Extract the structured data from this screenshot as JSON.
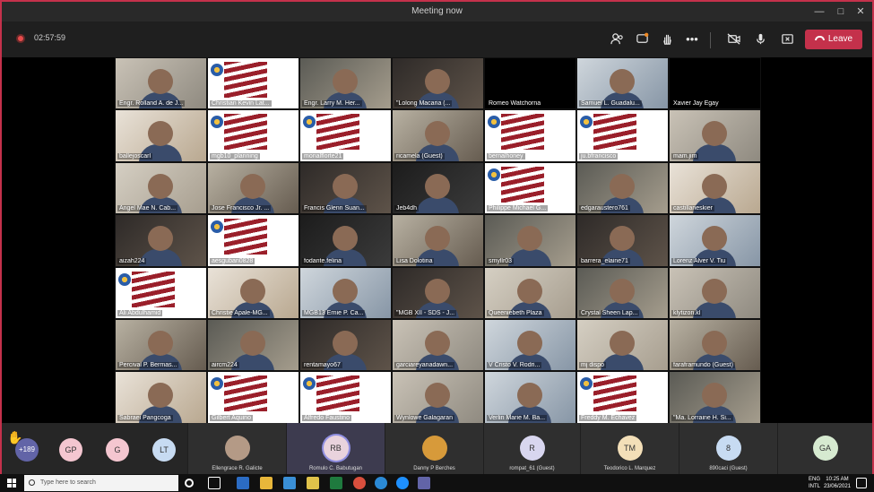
{
  "window": {
    "title": "Meeting now"
  },
  "toolbar": {
    "timer": "02:57:59",
    "leave_label": "Leave"
  },
  "tiles": [
    "Engr. Rolland A. de J...",
    "Christian Kevin Lat...",
    "Engr. Larry M. Her...",
    "\"Lolong Macaria (...",
    "Romeo Watchorna",
    "Samuel L. Guadalu...",
    "Xavier Jay Egay",
    "ballejoscarl",
    "mgb10_planning",
    "monalflorte21",
    "ricamela (Guest)",
    "bernalhoney",
    "ju.bfrancisco",
    "mam.jim",
    "Angel Mae N. Cab...",
    "Jose Francisco Jr. ...",
    "Francis Glenn Suan...",
    "Jeb4dh",
    "Philippe Michael G...",
    "edgaraustero761",
    "castillaneskier",
    "aizah224",
    "aesguban0828",
    "fodante.felina",
    "Lisa Dolotina",
    "smyllr03",
    "barrera_elaine71",
    "Lorenz Alver V. Tiu",
    "Ali Abdulhamid",
    "Christie Apale-MG...",
    "MGB13 Ernie P. Ca...",
    "\"MGB XII - SDS - J...",
    "Queeniebeth Plaza",
    "Crystal Sheen Lap...",
    "klytizon.kl",
    "Percival P. Bermas...",
    "aircm224",
    "rentamayo67",
    "garciareyanadawn...",
    "V Cristo V. Rodri...",
    "mj dispo",
    "faraframundo (Guest)",
    "Sabraei Pangcoga",
    "Gilbert Aquino",
    "Alfredo Faustino",
    "Wynlowe Galagaran",
    "Verlin Marie M. Ba...",
    "Freddy M. Echavez",
    "\"Ma. Lorraine H. Si..."
  ],
  "strip": {
    "overflow": "+189",
    "initials": [
      "GP",
      "G",
      "LT"
    ],
    "people": [
      {
        "name": "Ellengrace R. Galicte",
        "initials": ""
      },
      {
        "name": "Romulo C. Babutugan",
        "initials": "RB"
      },
      {
        "name": "Danny P Berches",
        "initials": ""
      },
      {
        "name": "rompat_61 (Guest)",
        "initials": "R"
      },
      {
        "name": "Teodorico L. Marquez",
        "initials": "TM"
      },
      {
        "name": "890caci (Guest)",
        "initials": "8"
      },
      {
        "name": "",
        "initials": "GA"
      }
    ]
  },
  "taskbar": {
    "search_placeholder": "Type here to search",
    "lang": "ENG",
    "layout": "INTL",
    "time": "10:25 AM",
    "date": "23/06/2021"
  },
  "colors": {
    "leave": "#c4314b",
    "accent": "#6264a7",
    "border": "#c4314b"
  }
}
